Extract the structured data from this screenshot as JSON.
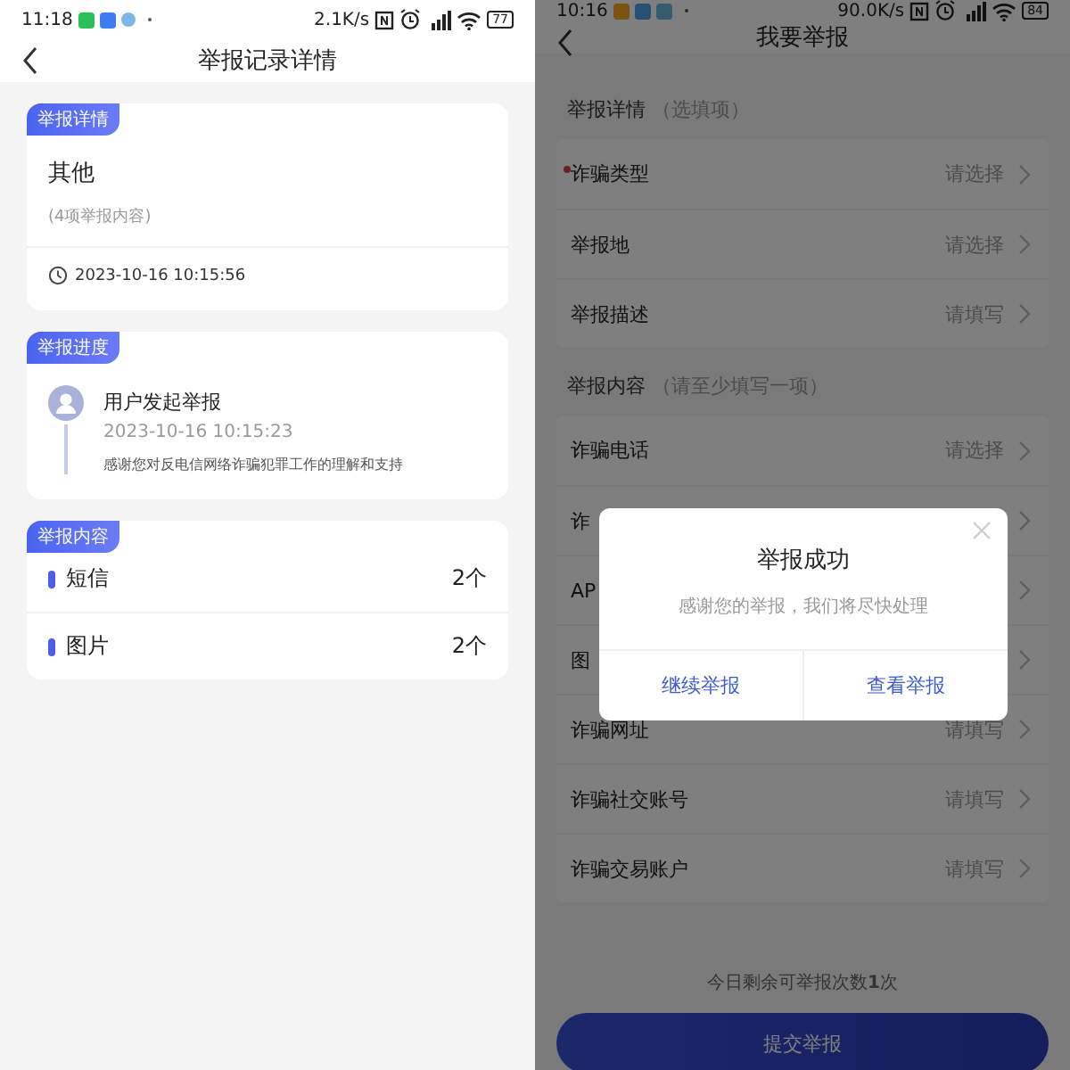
{
  "left": {
    "status_bar": {
      "time": "11:18",
      "speed": "2.1K/s",
      "battery": "77"
    },
    "title": "举报记录详情",
    "detail": {
      "tag": "举报详情",
      "category": "其他",
      "count_note": "(4项举报内容)",
      "time": "2023-10-16 10:15:56"
    },
    "progress": {
      "tag": "举报进度",
      "steps": [
        {
          "title": "用户发起举报",
          "time": "2023-10-16 10:15:23",
          "message": "感谢您对反电信网络诈骗犯罪工作的理解和支持"
        }
      ]
    },
    "content": {
      "tag": "举报内容",
      "items": [
        {
          "label": "短信",
          "count": "2个"
        },
        {
          "label": "图片",
          "count": "2个"
        }
      ]
    }
  },
  "right": {
    "status_bar": {
      "time": "10:16",
      "speed": "90.0K/s",
      "battery": "84"
    },
    "title": "我要举报",
    "sections": [
      {
        "title": "举报详情",
        "note": "（选填项）",
        "rows": [
          {
            "label": "诈骗类型",
            "value": "请选择",
            "required": true
          },
          {
            "label": "举报地",
            "value": "请选择",
            "required": false
          },
          {
            "label": "举报描述",
            "value": "请填写",
            "required": false
          }
        ]
      },
      {
        "title": "举报内容",
        "note": "（请至少填写一项）",
        "rows": [
          {
            "label": "诈骗电话",
            "value": "请选择",
            "required": false
          },
          {
            "label": "诈",
            "required": false
          },
          {
            "label": "AP",
            "required": false
          },
          {
            "label": "图",
            "required": false
          },
          {
            "label": "诈骗网址",
            "value": "请填写",
            "required": false
          },
          {
            "label": "诈骗社交账号",
            "value": "请填写",
            "required": false
          },
          {
            "label": "诈骗交易账户",
            "value": "请填写",
            "required": false
          }
        ]
      }
    ],
    "remaining": "今日剩余可举报次数**1**次",
    "submit": "提交举报",
    "dialog": {
      "title": "举报成功",
      "message": "感谢您的举报，我们将尽快处理",
      "buttons": [
        "继续举报",
        "查看举报"
      ]
    }
  }
}
